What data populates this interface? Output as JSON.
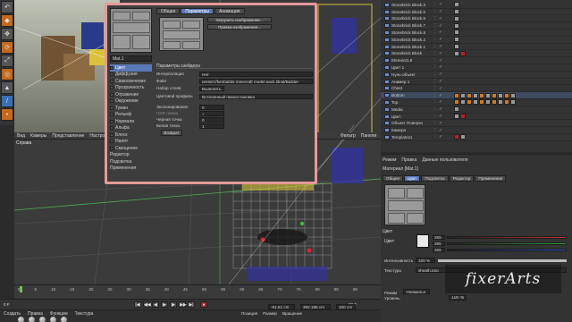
{
  "toolbar": {
    "left_icons": [
      "undo-icon",
      "cube-icon",
      "move-icon",
      "rotate-icon",
      "scale-icon",
      "live-select-icon",
      "polygon-icon",
      "edge-icon",
      "point-icon"
    ]
  },
  "viewport": {
    "menu": [
      "Вид",
      "Камеры",
      "Представление",
      "Настройки",
      "Фильтр",
      "Панели"
    ],
    "label": "Справа"
  },
  "material_dialog": {
    "tabs": [
      "Общее",
      "Параметры",
      "Анимация"
    ],
    "active_tab": "Параметры",
    "material_name": "Mat.1",
    "load_image_btn": "Загрузить изображение...",
    "edit_image_btn": "Правка изображения...",
    "channels": [
      {
        "label": "Цвет",
        "checked": true,
        "active": true
      },
      {
        "label": "Диффузия",
        "checked": false
      },
      {
        "label": "Самосвечение",
        "checked": false
      },
      {
        "label": "Прозрачность",
        "checked": false
      },
      {
        "label": "Отражение",
        "checked": false
      },
      {
        "label": "Окружение",
        "checked": false
      },
      {
        "label": "Туман",
        "checked": false
      },
      {
        "label": "Рельеф",
        "checked": false
      },
      {
        "label": "Нормали",
        "checked": false
      },
      {
        "label": "Альфа",
        "checked": false
      },
      {
        "label": "Блеск",
        "checked": false
      },
      {
        "label": "Налет",
        "checked": false
      },
      {
        "label": "Смещение",
        "checked": false
      },
      {
        "label": "Редактор",
        "checked": false
      },
      {
        "label": "Подсветка",
        "checked": false
      },
      {
        "label": "Применения",
        "checked": false
      }
    ],
    "shader_header": "Параметры шейдера",
    "interpolation_label": "Интерполяция",
    "interpolation_value": "Нет",
    "file_label": "Файл",
    "file_value": "preset://fumbabits minecraft model pack.lib4d/Builder",
    "layer_set_label": "Набор слоев",
    "layer_set_value": "Выделить...",
    "color_profile_label": "Цветовой профиль",
    "color_profile_value": "Встроенный предустановка",
    "exposure_label": "Экспонирование",
    "exposure_value": "0",
    "hdr_label": "HDR гамма",
    "hdr_value": "1",
    "black_point_label": "Черная точка",
    "black_point_value": "0",
    "white_point_label": "Белая точка",
    "white_point_value": "1",
    "reload_btn": "Возврат"
  },
  "object_manager": {
    "rows": [
      {
        "name": "Stonebrick Block.3",
        "tags": [
          "mat"
        ]
      },
      {
        "name": "Stonebrick Block.5",
        "tags": [
          "mat"
        ]
      },
      {
        "name": "Stonebrick Block.6",
        "tags": [
          "mat"
        ]
      },
      {
        "name": "Stonebrick Block.7",
        "tags": [
          "mat"
        ]
      },
      {
        "name": "Stonebrick Block.8",
        "tags": [
          "mat"
        ]
      },
      {
        "name": "Stonebrick Block.2",
        "tags": [
          "mat"
        ]
      },
      {
        "name": "Stonebrick Block.1",
        "tags": [
          "mat"
        ]
      },
      {
        "name": "Stonebrick Block",
        "tags": [
          "mat",
          "red"
        ]
      },
      {
        "name": "Element1.8",
        "tags": []
      },
      {
        "name": "Цвет 1",
        "tags": []
      },
      {
        "name": "Нуль-объект",
        "tags": []
      },
      {
        "name": "Анимер 1",
        "tags": []
      },
      {
        "name": "Chest",
        "tags": []
      },
      {
        "name": "Bottom",
        "tags": [
          "orange",
          "mat",
          "orange",
          "mat",
          "orange",
          "mat",
          "orange",
          "mat",
          "orange",
          "mat"
        ]
      },
      {
        "name": "Top",
        "tags": [
          "orange",
          "mat",
          "orange",
          "mat",
          "orange",
          "mat",
          "orange",
          "mat",
          "orange",
          "mat"
        ]
      },
      {
        "name": "Media",
        "tags": [
          "mat"
        ]
      },
      {
        "name": "Цвет",
        "tags": [
          "mat",
          "red"
        ]
      },
      {
        "name": "Объект Поверхн",
        "tags": []
      },
      {
        "name": "Камера",
        "tags": []
      },
      {
        "name": "Template11",
        "tags": [
          "red",
          "mat"
        ]
      }
    ],
    "selected_index": 13
  },
  "attribute_manager": {
    "top_tabs": [
      "Режим",
      "Правка",
      "Данные пользователя"
    ],
    "title": "Материал [Mat.1]",
    "tabs": [
      "Общее",
      "Цвет",
      "Подсветка",
      "Редактор",
      "Применение"
    ],
    "active_tab": "Цвет",
    "section": "Цвет",
    "color_label": "Цвет",
    "sliders": [
      {
        "label": "R",
        "value": "255",
        "color": "#c83030"
      },
      {
        "label": "G",
        "value": "255",
        "color": "#30a030"
      },
      {
        "label": "B",
        "value": "255",
        "color": "#3050c8"
      }
    ],
    "brightness_label": "Интенсивность",
    "brightness_value": "100 %",
    "texture_label": "Текстура",
    "texture_value": "sheath.png",
    "mode_label": "Режим",
    "mode_value": "Нормальн",
    "mix_label": "Уровень",
    "mix_value": "100 %"
  },
  "timeline": {
    "ticks": [
      "0",
      "5",
      "10",
      "15",
      "20",
      "25",
      "30",
      "35",
      "40",
      "45",
      "50",
      "55",
      "60",
      "65",
      "70",
      "75",
      "80",
      "85",
      "90"
    ],
    "current_frame": "0 F",
    "end_frame": "90 F"
  },
  "material_bar": {
    "menu": [
      "Создать",
      "Правка",
      "Функции",
      "Текстура"
    ],
    "coord_labels": [
      "Позиция",
      "Размер",
      "Вращение"
    ],
    "coord_values": [
      "-91.51 cm",
      "392.195 cm",
      "100 cm"
    ]
  },
  "watermark": "fixerArts"
}
